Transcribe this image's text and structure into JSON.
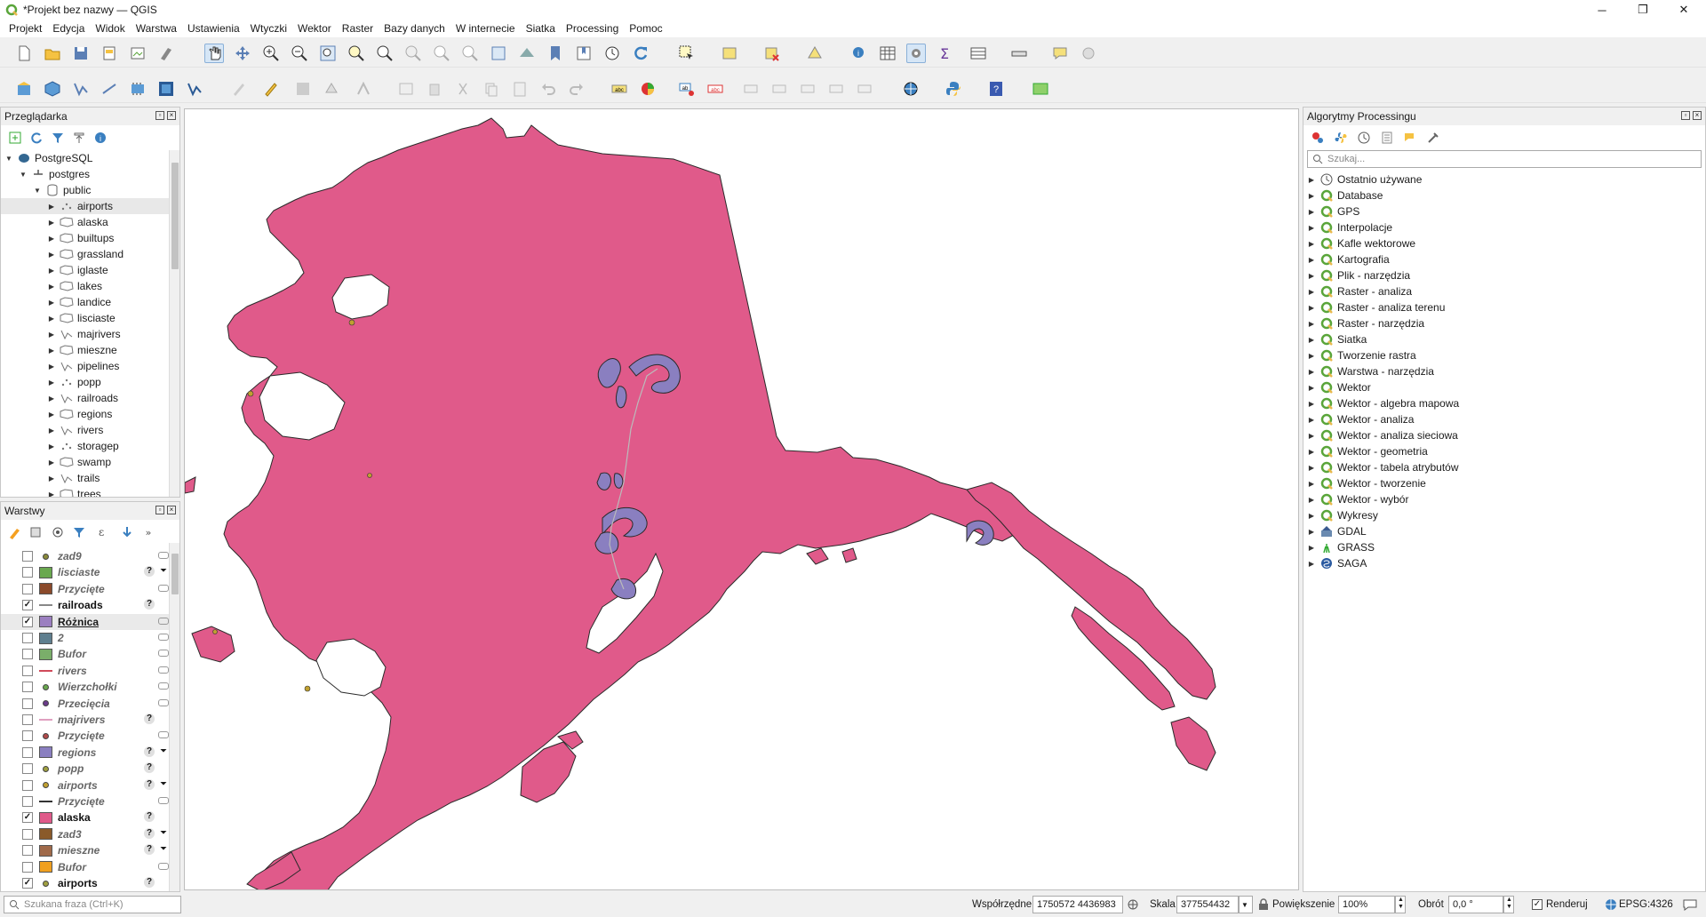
{
  "window": {
    "title": "*Projekt bez nazwy — QGIS",
    "minimize": "─",
    "maximize": "❐",
    "close": "✕"
  },
  "menu": [
    "Projekt",
    "Edycja",
    "Widok",
    "Warstwa",
    "Ustawienia",
    "Wtyczki",
    "Wektor",
    "Raster",
    "Bazy danych",
    "W internecie",
    "Siatka",
    "Processing",
    "Pomoc"
  ],
  "browser": {
    "title": "Przeglądarka",
    "root": "PostgreSQL",
    "connection": "postgres",
    "schema": "public",
    "tables": [
      {
        "name": "airports",
        "icon": "point-layer-icon"
      },
      {
        "name": "alaska",
        "icon": "polygon-layer-icon"
      },
      {
        "name": "builtups",
        "icon": "polygon-layer-icon"
      },
      {
        "name": "grassland",
        "icon": "polygon-layer-icon"
      },
      {
        "name": "iglaste",
        "icon": "polygon-layer-icon"
      },
      {
        "name": "lakes",
        "icon": "polygon-layer-icon"
      },
      {
        "name": "landice",
        "icon": "polygon-layer-icon"
      },
      {
        "name": "lisciaste",
        "icon": "polygon-layer-icon"
      },
      {
        "name": "majrivers",
        "icon": "line-layer-icon"
      },
      {
        "name": "mieszne",
        "icon": "polygon-layer-icon"
      },
      {
        "name": "pipelines",
        "icon": "line-layer-icon"
      },
      {
        "name": "popp",
        "icon": "point-layer-icon"
      },
      {
        "name": "railroads",
        "icon": "line-layer-icon"
      },
      {
        "name": "regions",
        "icon": "polygon-layer-icon"
      },
      {
        "name": "rivers",
        "icon": "line-layer-icon"
      },
      {
        "name": "storagep",
        "icon": "point-layer-icon"
      },
      {
        "name": "swamp",
        "icon": "polygon-layer-icon"
      },
      {
        "name": "trails",
        "icon": "line-layer-icon"
      },
      {
        "name": "trees",
        "icon": "polygon-layer-icon"
      }
    ]
  },
  "layers": {
    "title": "Warstwy",
    "items": [
      {
        "name": "zad9",
        "checked": false,
        "sym": "point",
        "color": "#8a8a3a",
        "style": "it",
        "ind": [
          "",
          "filter-off"
        ]
      },
      {
        "name": "lisciaste",
        "checked": false,
        "sym": "fill",
        "color": "#6aa84f",
        "style": "it",
        "ind": [
          "?",
          "filter"
        ]
      },
      {
        "name": "Przycięte",
        "checked": false,
        "sym": "fill",
        "color": "#8b4a2b",
        "style": "it",
        "ind": [
          "",
          "filter-off"
        ]
      },
      {
        "name": "railroads",
        "checked": true,
        "sym": "line",
        "color": "#888888",
        "style": "bd",
        "ind": [
          "?",
          ""
        ]
      },
      {
        "name": "Różnica",
        "checked": true,
        "sym": "fill",
        "color": "#9b7fc0",
        "style": "ul",
        "ind": [
          "",
          "filter-off"
        ]
      },
      {
        "name": "2",
        "checked": false,
        "sym": "fill",
        "color": "#5f7f8f",
        "style": "it",
        "ind": [
          "",
          "filter-off"
        ]
      },
      {
        "name": "Bufor",
        "checked": false,
        "sym": "fill",
        "color": "#7aae6a",
        "style": "it",
        "ind": [
          "",
          "filter-off"
        ]
      },
      {
        "name": "rivers",
        "checked": false,
        "sym": "line",
        "color": "#d04a5a",
        "style": "it",
        "ind": [
          "",
          "filter-off"
        ]
      },
      {
        "name": "Wierzchołki",
        "checked": false,
        "sym": "point",
        "color": "#6aa84f",
        "style": "it",
        "ind": [
          "",
          "filter-off"
        ]
      },
      {
        "name": "Przecięcia",
        "checked": false,
        "sym": "point",
        "color": "#6a3a8a",
        "style": "it",
        "ind": [
          "",
          "filter-off"
        ]
      },
      {
        "name": "majrivers",
        "checked": false,
        "sym": "line",
        "color": "#e0a0c0",
        "style": "it",
        "ind": [
          "?",
          ""
        ]
      },
      {
        "name": "Przycięte",
        "checked": false,
        "sym": "point",
        "color": "#b04a4a",
        "style": "it",
        "ind": [
          "",
          "filter-off"
        ]
      },
      {
        "name": "regions",
        "checked": false,
        "sym": "fill",
        "color": "#8a7fc0",
        "style": "it",
        "ind": [
          "?",
          "filter"
        ]
      },
      {
        "name": "popp",
        "checked": false,
        "sym": "point",
        "color": "#a0a040",
        "style": "it",
        "ind": [
          "?",
          ""
        ]
      },
      {
        "name": "airports",
        "checked": false,
        "sym": "point",
        "color": "#c0a030",
        "style": "it",
        "ind": [
          "?",
          "filter"
        ]
      },
      {
        "name": "Przycięte",
        "checked": false,
        "sym": "line",
        "color": "#333333",
        "style": "it",
        "ind": [
          "",
          "filter-off"
        ]
      },
      {
        "name": "alaska",
        "checked": true,
        "sym": "fill",
        "color": "#e05a8a",
        "style": "bd",
        "ind": [
          "?",
          ""
        ]
      },
      {
        "name": "zad3",
        "checked": false,
        "sym": "fill",
        "color": "#8a5a2a",
        "style": "it",
        "ind": [
          "?",
          "filter"
        ]
      },
      {
        "name": "mieszne",
        "checked": false,
        "sym": "fill",
        "color": "#a06a4a",
        "style": "it",
        "ind": [
          "?",
          "filter"
        ]
      },
      {
        "name": "Bufor",
        "checked": false,
        "sym": "fill",
        "color": "#f0a020",
        "style": "it",
        "ind": [
          "",
          "filter-off"
        ]
      },
      {
        "name": "airports",
        "checked": true,
        "sym": "point",
        "color": "#a0a040",
        "style": "bd",
        "ind": [
          "?",
          ""
        ]
      }
    ]
  },
  "processing": {
    "title": "Algorytmy Processingu",
    "search_placeholder": "Szukaj...",
    "groups": [
      {
        "name": "Ostatnio używane",
        "icon": "clock-icon"
      },
      {
        "name": "Database",
        "icon": "qgis-icon"
      },
      {
        "name": "GPS",
        "icon": "qgis-icon"
      },
      {
        "name": "Interpolacje",
        "icon": "qgis-icon"
      },
      {
        "name": "Kafle wektorowe",
        "icon": "qgis-icon"
      },
      {
        "name": "Kartografia",
        "icon": "qgis-icon"
      },
      {
        "name": "Plik - narzędzia",
        "icon": "qgis-icon"
      },
      {
        "name": "Raster - analiza",
        "icon": "qgis-icon"
      },
      {
        "name": "Raster - analiza terenu",
        "icon": "qgis-icon"
      },
      {
        "name": "Raster - narzędzia",
        "icon": "qgis-icon"
      },
      {
        "name": "Siatka",
        "icon": "qgis-icon"
      },
      {
        "name": "Tworzenie rastra",
        "icon": "qgis-icon"
      },
      {
        "name": "Warstwa - narzędzia",
        "icon": "qgis-icon"
      },
      {
        "name": "Wektor",
        "icon": "qgis-icon"
      },
      {
        "name": "Wektor - algebra mapowa",
        "icon": "qgis-icon"
      },
      {
        "name": "Wektor - analiza",
        "icon": "qgis-icon"
      },
      {
        "name": "Wektor - analiza sieciowa",
        "icon": "qgis-icon"
      },
      {
        "name": "Wektor - geometria",
        "icon": "qgis-icon"
      },
      {
        "name": "Wektor - tabela atrybutów",
        "icon": "qgis-icon"
      },
      {
        "name": "Wektor - tworzenie",
        "icon": "qgis-icon"
      },
      {
        "name": "Wektor - wybór",
        "icon": "qgis-icon"
      },
      {
        "name": "Wykresy",
        "icon": "qgis-icon"
      },
      {
        "name": "GDAL",
        "icon": "gdal-icon"
      },
      {
        "name": "GRASS",
        "icon": "grass-icon"
      },
      {
        "name": "SAGA",
        "icon": "saga-icon"
      }
    ]
  },
  "status": {
    "locator_placeholder": "Szukana fraza (Ctrl+K)",
    "coord_label": "Współrzędne",
    "coord_value": "1750572 4436983",
    "scale_label": "Skala",
    "scale_value": "377554432",
    "magnifier_label": "Powiększenie",
    "magnifier_value": "100%",
    "rotation_label": "Obrót",
    "rotation_value": "0,0 °",
    "render_label": "Renderuj",
    "crs": "EPSG:4326"
  },
  "map": {
    "land_color": "#e05a8a",
    "buffer_color": "#8a7fc0"
  }
}
